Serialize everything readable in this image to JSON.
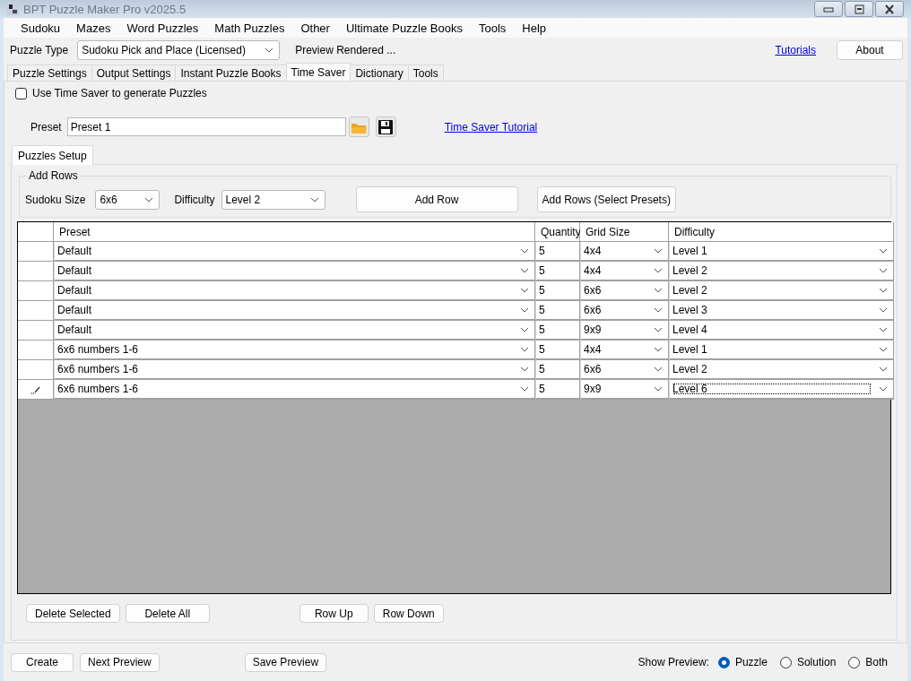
{
  "window": {
    "title": "BPT Puzzle Maker Pro v2025.5"
  },
  "menu": [
    "Sudoku",
    "Mazes",
    "Word Puzzles",
    "Math Puzzles",
    "Other",
    "Ultimate Puzzle Books",
    "Tools",
    "Help"
  ],
  "puzzle_type": {
    "label": "Puzzle Type",
    "value": "Sudoku Pick and Place (Licensed)"
  },
  "status": "Preview Rendered ...",
  "tutorials_link": "Tutorials",
  "about_button": "About",
  "tabs": [
    {
      "label": "Puzzle Settings",
      "selected": false
    },
    {
      "label": "Output Settings",
      "selected": false
    },
    {
      "label": "Instant Puzzle Books",
      "selected": false
    },
    {
      "label": "Time Saver",
      "selected": true
    },
    {
      "label": "Dictionary",
      "selected": false
    },
    {
      "label": "Tools",
      "selected": false
    }
  ],
  "use_time_saver": {
    "label": "Use Time Saver to generate Puzzles",
    "checked": false
  },
  "preset": {
    "label": "Preset",
    "value": "Preset 1"
  },
  "time_saver_tutorial_link": "Time Saver Tutorial",
  "inner_tabs": [
    {
      "label": "Puzzles Setup",
      "selected": true
    }
  ],
  "add_rows": {
    "title": "Add Rows",
    "sudoku_size": {
      "label": "Sudoku Size",
      "value": "6x6"
    },
    "difficulty": {
      "label": "Difficulty",
      "value": "Level 2"
    },
    "buttons": [
      "Add Row",
      "Add Rows (Select Presets)"
    ]
  },
  "table": {
    "columns": [
      "Preset",
      "Quantity",
      "Grid Size",
      "Difficulty"
    ],
    "rows": [
      {
        "preset": "Default",
        "quantity": "5",
        "grid_size": "4x4",
        "difficulty": "Level 1",
        "editing": false
      },
      {
        "preset": "Default",
        "quantity": "5",
        "grid_size": "4x4",
        "difficulty": "Level 2",
        "editing": false
      },
      {
        "preset": "Default",
        "quantity": "5",
        "grid_size": "6x6",
        "difficulty": "Level 2",
        "editing": false
      },
      {
        "preset": "Default",
        "quantity": "5",
        "grid_size": "6x6",
        "difficulty": "Level 3",
        "editing": false
      },
      {
        "preset": "Default",
        "quantity": "5",
        "grid_size": "9x9",
        "difficulty": "Level 4",
        "editing": false
      },
      {
        "preset": "6x6 numbers 1-6",
        "quantity": "5",
        "grid_size": "4x4",
        "difficulty": "Level 1",
        "editing": false
      },
      {
        "preset": "6x6 numbers 1-6",
        "quantity": "5",
        "grid_size": "6x6",
        "difficulty": "Level 2",
        "editing": false
      },
      {
        "preset": "6x6 numbers 1-6",
        "quantity": "5",
        "grid_size": "9x9",
        "difficulty": "Level 6",
        "editing": true
      }
    ]
  },
  "grid_buttons": [
    [
      "Delete Selected",
      "Delete All"
    ],
    [
      "Row Up",
      "Row Down"
    ]
  ],
  "footer": {
    "buttons": [
      [
        "Create",
        "Next Preview"
      ],
      [
        "Save Preview"
      ]
    ],
    "show_preview": {
      "label": "Show Preview:",
      "options": [
        {
          "label": "Puzzle",
          "selected": true
        },
        {
          "label": "Solution",
          "selected": false
        },
        {
          "label": "Both",
          "selected": false
        }
      ]
    }
  }
}
